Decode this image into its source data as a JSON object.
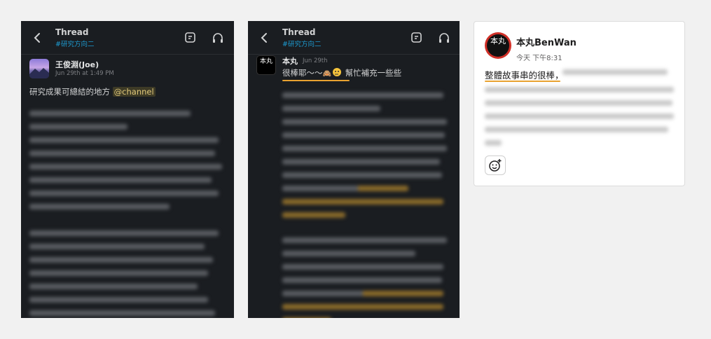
{
  "panels": [
    {
      "header": {
        "title": "Thread",
        "channel": "#研究方向二"
      },
      "message": {
        "author": "王俊淵(Joe)",
        "time": "Jun 29th at 1:49 PM",
        "text": "研究成果可總結的地方 ",
        "mention": "@channel"
      }
    },
    {
      "header": {
        "title": "Thread",
        "channel": "#研究方向二"
      },
      "message": {
        "author": "本丸",
        "time": "Jun 29th",
        "text": "很棒耶～～",
        "text_after_emoji": " 幫忙補充一些些",
        "emoji": "🙈"
      },
      "avatar_text": "本丸"
    }
  ],
  "card": {
    "avatar_text": "本丸",
    "author": "本丸BenWan",
    "time": "今天 下午8:31",
    "text": "整體故事串的很棒，"
  },
  "colors": {
    "accent_underline": "#e8a230",
    "channel_link": "#1d9bd1",
    "mention_bg": "#3d3a26"
  },
  "icons": [
    "back-chevron-icon",
    "canvas-note-icon",
    "headphones-icon",
    "add-reaction-icon"
  ]
}
